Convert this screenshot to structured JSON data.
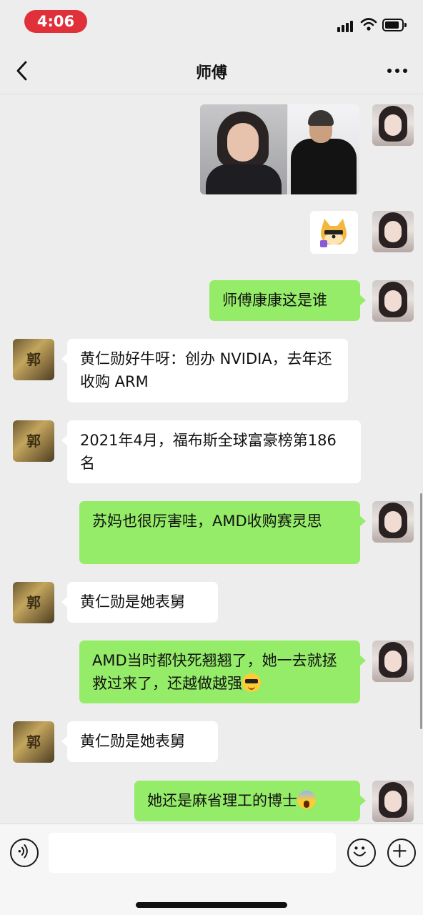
{
  "status_bar": {
    "time": "4:06",
    "icons": [
      "signal-icon",
      "wifi-icon",
      "battery-icon"
    ]
  },
  "nav": {
    "title": "师傅",
    "back_icon": "chevron-left-icon",
    "more_icon": "more-dots-icon"
  },
  "contacts": {
    "other_avatar_text": "郭"
  },
  "messages": [
    {
      "sender": "me",
      "type": "image",
      "content": "two-portrait-photo"
    },
    {
      "sender": "me",
      "type": "sticker",
      "content": "doge-sticker"
    },
    {
      "sender": "me",
      "type": "text",
      "text": "师傅康康这是谁"
    },
    {
      "sender": "other",
      "type": "text",
      "text": "黄仁勋好牛呀：创办 NVIDIA，去年还收购 ARM"
    },
    {
      "sender": "other",
      "type": "text",
      "text": "2021年4月，福布斯全球富豪榜第186名"
    },
    {
      "sender": "me",
      "type": "text",
      "text": "苏妈也很厉害哇，AMD收购赛灵思"
    },
    {
      "sender": "other",
      "type": "text",
      "text": "黄仁勋是她表舅"
    },
    {
      "sender": "me",
      "type": "text",
      "text": "AMD当时都快死翘翘了，她一去就拯救过来了，还越做越强",
      "emoji": "sunglasses-emoji"
    },
    {
      "sender": "other",
      "type": "text",
      "text": "黄仁勋是她表舅"
    },
    {
      "sender": "me",
      "type": "text",
      "text": "她还是麻省理工的博士",
      "emoji": "screaming-face-emoji"
    }
  ],
  "input_bar": {
    "placeholder": "",
    "icons": [
      "voice-icon",
      "emoji-icon",
      "plus-icon"
    ]
  },
  "colors": {
    "background": "#ededed",
    "my_bubble": "#95ec69",
    "their_bubble": "#ffffff",
    "time_pill": "#e0313a"
  }
}
